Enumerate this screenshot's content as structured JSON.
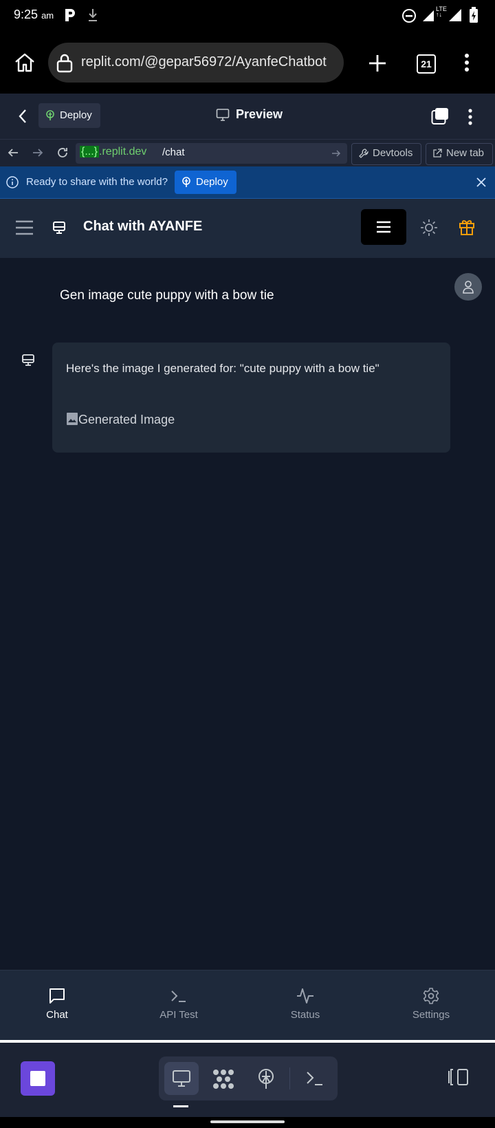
{
  "status_bar": {
    "time": "9:25",
    "ampm": "am"
  },
  "browser": {
    "url": "replit.com/@gepar56972/AyanfeChatbot",
    "tab_count": "21"
  },
  "replit_top": {
    "deploy_label": "Deploy",
    "preview_label": "Preview"
  },
  "webview_nav": {
    "domain_token": "{...}",
    "domain_rest": ".replit.dev",
    "path": "/chat",
    "devtools_label": "Devtools",
    "newtab_label": "New tab"
  },
  "banner": {
    "message": "Ready to share with the world?",
    "deploy_label": "Deploy"
  },
  "app": {
    "title": "Chat with AYANFE",
    "accent_gift": "#f59e0b",
    "messages": {
      "user_text": "Gen image cute puppy with a bow tie",
      "bot_text": "Here's the image I generated for: \"cute puppy with a bow tie\"",
      "bot_image_alt": "Generated Image"
    },
    "bottom_nav": [
      {
        "label": "Chat",
        "icon": "chat-bubble-icon",
        "active": true
      },
      {
        "label": "API Test",
        "icon": "terminal-icon",
        "active": false
      },
      {
        "label": "Status",
        "icon": "activity-icon",
        "active": false
      },
      {
        "label": "Settings",
        "icon": "gear-icon",
        "active": false
      }
    ]
  }
}
